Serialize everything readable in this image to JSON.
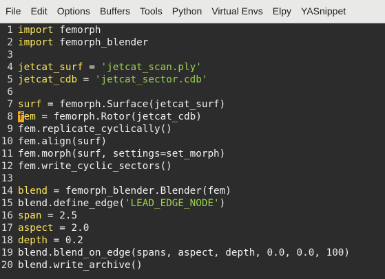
{
  "menu": [
    "File",
    "Edit",
    "Options",
    "Buffers",
    "Tools",
    "Python",
    "Virtual Envs",
    "Elpy",
    "YASnippet"
  ],
  "editor": {
    "lines": [
      {
        "n": "1",
        "tokens": [
          {
            "t": "import",
            "c": "kw"
          },
          {
            "t": " femorph",
            "c": "plain"
          }
        ]
      },
      {
        "n": "2",
        "tokens": [
          {
            "t": "import",
            "c": "kw"
          },
          {
            "t": " femorph_blender",
            "c": "plain"
          }
        ]
      },
      {
        "n": "3",
        "tokens": []
      },
      {
        "n": "4",
        "tokens": [
          {
            "t": "jetcat_surf",
            "c": "var"
          },
          {
            "t": " = ",
            "c": "plain"
          },
          {
            "t": "'jetcat_scan.ply'",
            "c": "str"
          }
        ]
      },
      {
        "n": "5",
        "tokens": [
          {
            "t": "jetcat_cdb",
            "c": "var"
          },
          {
            "t": " = ",
            "c": "plain"
          },
          {
            "t": "'jetcat_sector.cdb'",
            "c": "str"
          }
        ]
      },
      {
        "n": "6",
        "tokens": []
      },
      {
        "n": "7",
        "tokens": [
          {
            "t": "surf",
            "c": "var"
          },
          {
            "t": " = femorph.Surface(jetcat_surf)",
            "c": "plain"
          }
        ]
      },
      {
        "n": "8",
        "tokens": [
          {
            "t": "f",
            "c": "cursor"
          },
          {
            "t": "em",
            "c": "var"
          },
          {
            "t": " = femorph.Rotor(jetcat_cdb)",
            "c": "plain"
          }
        ]
      },
      {
        "n": "9",
        "tokens": [
          {
            "t": "fem.replicate_cyclically()",
            "c": "plain"
          }
        ]
      },
      {
        "n": "10",
        "tokens": [
          {
            "t": "fem.align(surf)",
            "c": "plain"
          }
        ]
      },
      {
        "n": "11",
        "tokens": [
          {
            "t": "fem.morph(surf, settings=set_morph)",
            "c": "plain"
          }
        ]
      },
      {
        "n": "12",
        "tokens": [
          {
            "t": "fem.write_cyclic_sectors()",
            "c": "plain"
          }
        ]
      },
      {
        "n": "13",
        "tokens": []
      },
      {
        "n": "14",
        "tokens": [
          {
            "t": "blend",
            "c": "var"
          },
          {
            "t": " = femorph_blender.Blender(fem)",
            "c": "plain"
          }
        ]
      },
      {
        "n": "15",
        "tokens": [
          {
            "t": "blend.define_edge(",
            "c": "plain"
          },
          {
            "t": "'LEAD_EDGE_NODE'",
            "c": "str"
          },
          {
            "t": ")",
            "c": "plain"
          }
        ]
      },
      {
        "n": "16",
        "tokens": [
          {
            "t": "span",
            "c": "var"
          },
          {
            "t": " = 2.5",
            "c": "plain"
          }
        ]
      },
      {
        "n": "17",
        "tokens": [
          {
            "t": "aspect",
            "c": "var"
          },
          {
            "t": " = 2.0",
            "c": "plain"
          }
        ]
      },
      {
        "n": "18",
        "tokens": [
          {
            "t": "depth",
            "c": "var"
          },
          {
            "t": " = 0.2",
            "c": "plain"
          }
        ]
      },
      {
        "n": "19",
        "tokens": [
          {
            "t": "blend.blend_on_edge(spans, aspect, depth, 0.0, 0.0, 100)",
            "c": "plain"
          }
        ]
      },
      {
        "n": "20",
        "tokens": [
          {
            "t": "blend.write_archive()",
            "c": "plain"
          }
        ]
      }
    ]
  },
  "colors": {
    "background": "#2c2c2c",
    "keyword": "#f7e35a",
    "string": "#9ad24a",
    "cursor": "#f5a623",
    "menubar": "#e9e9e7"
  }
}
